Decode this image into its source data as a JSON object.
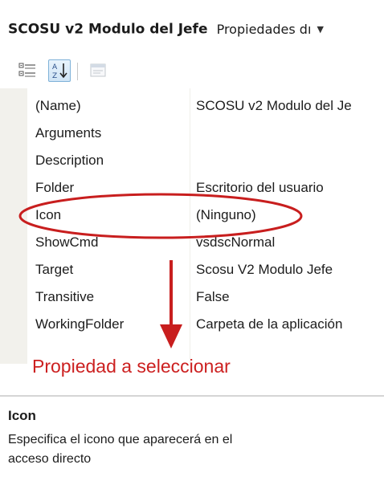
{
  "header": {
    "object_name": "SCOSU v2 Modulo del Jefe",
    "object_type": "Propiedades dı"
  },
  "toolbar": {
    "categorized_icon": "categorized-icon",
    "alphabetical_icon": "alphabetical-sort-icon",
    "property_pages_icon": "property-pages-icon"
  },
  "properties": [
    {
      "name": "(Name)",
      "value": "SCOSU v2 Modulo del Je"
    },
    {
      "name": "Arguments",
      "value": ""
    },
    {
      "name": "Description",
      "value": ""
    },
    {
      "name": "Folder",
      "value": "Escritorio del usuario"
    },
    {
      "name": "Icon",
      "value": "(Ninguno)"
    },
    {
      "name": "ShowCmd",
      "value": "vsdscNormal"
    },
    {
      "name": "Target",
      "value": "Scosu V2 Modulo Jefe"
    },
    {
      "name": "Transitive",
      "value": "False"
    },
    {
      "name": "WorkingFolder",
      "value": "Carpeta de la aplicación"
    }
  ],
  "annotation": {
    "label": "Propiedad a seleccionar",
    "color": "#cc2020"
  },
  "description": {
    "title": "Icon",
    "text": "Especifica el icono que aparecerá en el acceso directo"
  }
}
